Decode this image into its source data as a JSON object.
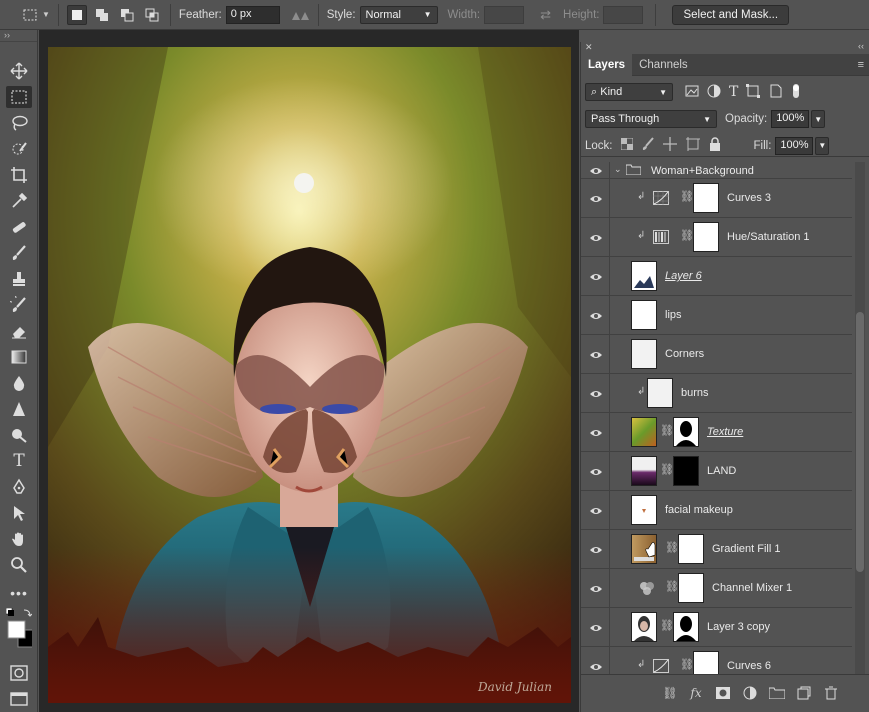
{
  "options_bar": {
    "feather_label": "Feather:",
    "feather_value": "0 px",
    "style_label": "Style:",
    "style_value": "Normal",
    "width_label": "Width:",
    "height_label": "Height:",
    "select_mask_label": "Select and Mask..."
  },
  "panel": {
    "tabs": [
      "Layers",
      "Channels"
    ],
    "filter_kind": "Kind",
    "blend_mode": "Pass Through",
    "opacity_label": "Opacity:",
    "opacity_value": "100%",
    "lock_label": "Lock:",
    "fill_label": "Fill:",
    "fill_value": "100%"
  },
  "layers": [
    {
      "name": "Woman+Background",
      "kind": "group"
    },
    {
      "name": "Curves 3",
      "kind": "adjustment-clipped"
    },
    {
      "name": "Hue/Saturation 1",
      "kind": "adjustment-clipped"
    },
    {
      "name": "Layer 6",
      "kind": "pixel",
      "underlined": true
    },
    {
      "name": "lips",
      "kind": "pixel"
    },
    {
      "name": "Corners",
      "kind": "pixel"
    },
    {
      "name": "burns",
      "kind": "pixel-clipped"
    },
    {
      "name": "Texture",
      "kind": "masked",
      "underlined": true
    },
    {
      "name": "LAND",
      "kind": "masked"
    },
    {
      "name": "facial makeup",
      "kind": "pixel"
    },
    {
      "name": "Gradient Fill 1",
      "kind": "fill"
    },
    {
      "name": "Channel Mixer 1",
      "kind": "adjustment"
    },
    {
      "name": "Layer 3 copy",
      "kind": "masked"
    },
    {
      "name": "Curves 6",
      "kind": "adjustment-clipped"
    }
  ],
  "artwork": {
    "signature": "David Julian"
  },
  "colors": {
    "ui_bg": "#535353",
    "panel_dark": "#424242",
    "canvas_bg": "#282828"
  }
}
